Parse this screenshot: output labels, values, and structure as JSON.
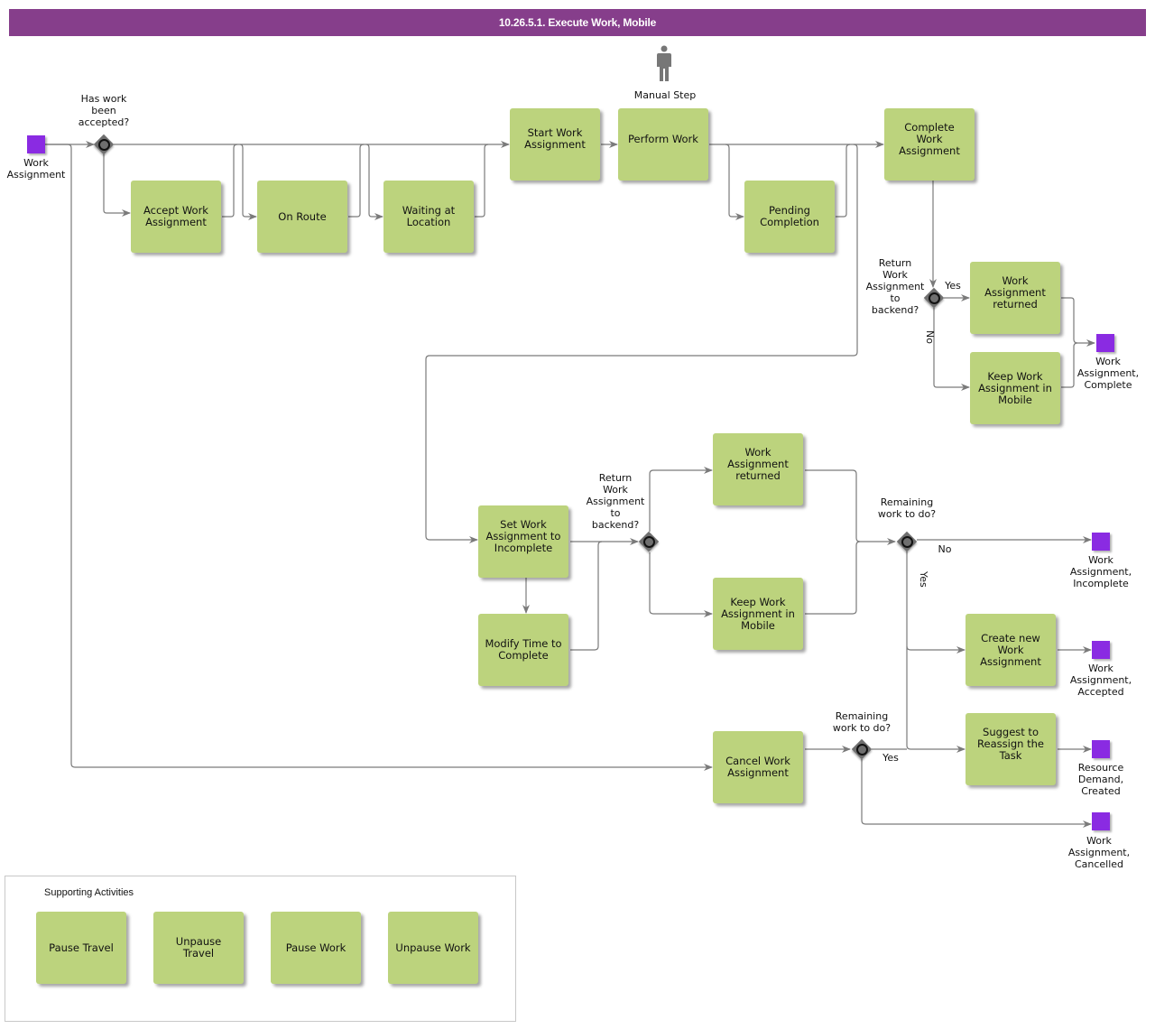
{
  "title": "10.26.5.1. Execute Work, Mobile",
  "colors": {
    "title_bar": "#863e8b",
    "task_fill": "#bcd37d",
    "event_fill": "#8a2be2",
    "gateway_fill": "#6f6f6f",
    "connector": "#7a7a7a"
  },
  "manual_step": {
    "icon": "person-icon",
    "label": "Manual Step"
  },
  "start_event": {
    "label": "Work\nAssignment"
  },
  "gateways": {
    "accepted": {
      "label": "Has work\nbeen\naccepted?"
    },
    "return_top": {
      "label": "Return\nWork\nAssignment\nto\nbackend?",
      "yes": "Yes",
      "no": "No"
    },
    "return_mid": {
      "label": "Return\nWork\nAssignment\nto\nbackend?"
    },
    "remaining_mid": {
      "label": "Remaining\nwork to do?",
      "no": "No",
      "yes": "Yes"
    },
    "remaining_cancel": {
      "label": "Remaining\nwork to do?",
      "yes": "Yes"
    }
  },
  "tasks": {
    "accept": "Accept Work Assignment",
    "on_route": "On Route",
    "waiting": "Waiting at Location",
    "start": "Start Work Assignment",
    "perform": "Perform Work",
    "pending": "Pending Completion",
    "complete": "Complete Work Assignment",
    "returned_top": "Work Assignment returned",
    "keep_top": "Keep Work Assignment in Mobile",
    "set_incomplete": "Set Work Assignment to Incomplete",
    "modify_time": "Modify Time to Complete",
    "returned_mid": "Work Assignment returned",
    "keep_mid": "Keep Work Assignment in Mobile",
    "create_new": "Create new Work Assignment",
    "suggest": "Suggest to Reassign the Task",
    "cancel": "Cancel Work Assignment"
  },
  "end_events": {
    "complete": "Work\nAssignment,\nComplete",
    "incomplete": "Work\nAssignment,\nIncomplete",
    "accepted": "Work\nAssignment,\nAccepted",
    "resource_demand": "Resource\nDemand,\nCreated",
    "cancelled": "Work\nAssignment,\nCancelled"
  },
  "supporting": {
    "title": "Supporting Activities",
    "items": [
      "Pause Travel",
      "Unpause Travel",
      "Pause Work",
      "Unpause Work"
    ]
  }
}
